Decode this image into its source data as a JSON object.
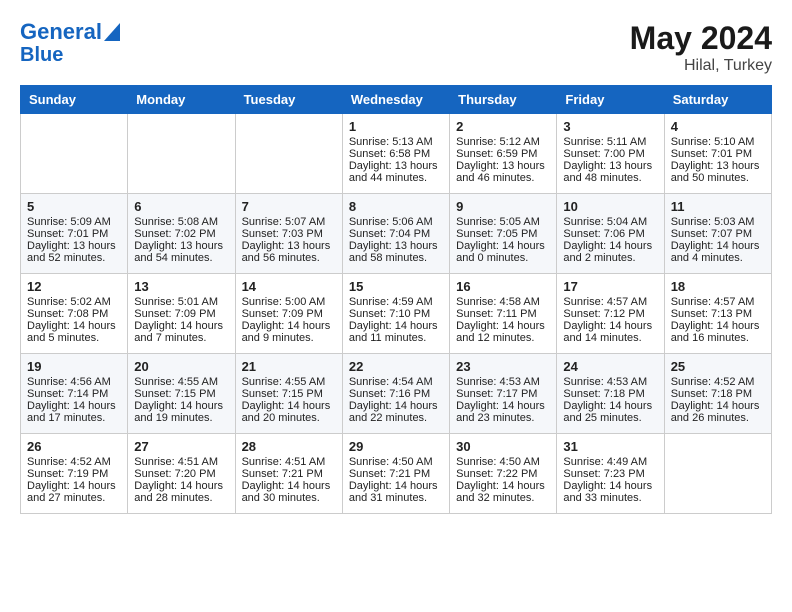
{
  "header": {
    "logo_line1": "General",
    "logo_line2": "Blue",
    "month_year": "May 2024",
    "location": "Hilal, Turkey"
  },
  "weekdays": [
    "Sunday",
    "Monday",
    "Tuesday",
    "Wednesday",
    "Thursday",
    "Friday",
    "Saturday"
  ],
  "weeks": [
    [
      {
        "day": "",
        "sunrise": "",
        "sunset": "",
        "daylight": ""
      },
      {
        "day": "",
        "sunrise": "",
        "sunset": "",
        "daylight": ""
      },
      {
        "day": "",
        "sunrise": "",
        "sunset": "",
        "daylight": ""
      },
      {
        "day": "1",
        "sunrise": "Sunrise: 5:13 AM",
        "sunset": "Sunset: 6:58 PM",
        "daylight": "Daylight: 13 hours and 44 minutes."
      },
      {
        "day": "2",
        "sunrise": "Sunrise: 5:12 AM",
        "sunset": "Sunset: 6:59 PM",
        "daylight": "Daylight: 13 hours and 46 minutes."
      },
      {
        "day": "3",
        "sunrise": "Sunrise: 5:11 AM",
        "sunset": "Sunset: 7:00 PM",
        "daylight": "Daylight: 13 hours and 48 minutes."
      },
      {
        "day": "4",
        "sunrise": "Sunrise: 5:10 AM",
        "sunset": "Sunset: 7:01 PM",
        "daylight": "Daylight: 13 hours and 50 minutes."
      }
    ],
    [
      {
        "day": "5",
        "sunrise": "Sunrise: 5:09 AM",
        "sunset": "Sunset: 7:01 PM",
        "daylight": "Daylight: 13 hours and 52 minutes."
      },
      {
        "day": "6",
        "sunrise": "Sunrise: 5:08 AM",
        "sunset": "Sunset: 7:02 PM",
        "daylight": "Daylight: 13 hours and 54 minutes."
      },
      {
        "day": "7",
        "sunrise": "Sunrise: 5:07 AM",
        "sunset": "Sunset: 7:03 PM",
        "daylight": "Daylight: 13 hours and 56 minutes."
      },
      {
        "day": "8",
        "sunrise": "Sunrise: 5:06 AM",
        "sunset": "Sunset: 7:04 PM",
        "daylight": "Daylight: 13 hours and 58 minutes."
      },
      {
        "day": "9",
        "sunrise": "Sunrise: 5:05 AM",
        "sunset": "Sunset: 7:05 PM",
        "daylight": "Daylight: 14 hours and 0 minutes."
      },
      {
        "day": "10",
        "sunrise": "Sunrise: 5:04 AM",
        "sunset": "Sunset: 7:06 PM",
        "daylight": "Daylight: 14 hours and 2 minutes."
      },
      {
        "day": "11",
        "sunrise": "Sunrise: 5:03 AM",
        "sunset": "Sunset: 7:07 PM",
        "daylight": "Daylight: 14 hours and 4 minutes."
      }
    ],
    [
      {
        "day": "12",
        "sunrise": "Sunrise: 5:02 AM",
        "sunset": "Sunset: 7:08 PM",
        "daylight": "Daylight: 14 hours and 5 minutes."
      },
      {
        "day": "13",
        "sunrise": "Sunrise: 5:01 AM",
        "sunset": "Sunset: 7:09 PM",
        "daylight": "Daylight: 14 hours and 7 minutes."
      },
      {
        "day": "14",
        "sunrise": "Sunrise: 5:00 AM",
        "sunset": "Sunset: 7:09 PM",
        "daylight": "Daylight: 14 hours and 9 minutes."
      },
      {
        "day": "15",
        "sunrise": "Sunrise: 4:59 AM",
        "sunset": "Sunset: 7:10 PM",
        "daylight": "Daylight: 14 hours and 11 minutes."
      },
      {
        "day": "16",
        "sunrise": "Sunrise: 4:58 AM",
        "sunset": "Sunset: 7:11 PM",
        "daylight": "Daylight: 14 hours and 12 minutes."
      },
      {
        "day": "17",
        "sunrise": "Sunrise: 4:57 AM",
        "sunset": "Sunset: 7:12 PM",
        "daylight": "Daylight: 14 hours and 14 minutes."
      },
      {
        "day": "18",
        "sunrise": "Sunrise: 4:57 AM",
        "sunset": "Sunset: 7:13 PM",
        "daylight": "Daylight: 14 hours and 16 minutes."
      }
    ],
    [
      {
        "day": "19",
        "sunrise": "Sunrise: 4:56 AM",
        "sunset": "Sunset: 7:14 PM",
        "daylight": "Daylight: 14 hours and 17 minutes."
      },
      {
        "day": "20",
        "sunrise": "Sunrise: 4:55 AM",
        "sunset": "Sunset: 7:15 PM",
        "daylight": "Daylight: 14 hours and 19 minutes."
      },
      {
        "day": "21",
        "sunrise": "Sunrise: 4:55 AM",
        "sunset": "Sunset: 7:15 PM",
        "daylight": "Daylight: 14 hours and 20 minutes."
      },
      {
        "day": "22",
        "sunrise": "Sunrise: 4:54 AM",
        "sunset": "Sunset: 7:16 PM",
        "daylight": "Daylight: 14 hours and 22 minutes."
      },
      {
        "day": "23",
        "sunrise": "Sunrise: 4:53 AM",
        "sunset": "Sunset: 7:17 PM",
        "daylight": "Daylight: 14 hours and 23 minutes."
      },
      {
        "day": "24",
        "sunrise": "Sunrise: 4:53 AM",
        "sunset": "Sunset: 7:18 PM",
        "daylight": "Daylight: 14 hours and 25 minutes."
      },
      {
        "day": "25",
        "sunrise": "Sunrise: 4:52 AM",
        "sunset": "Sunset: 7:18 PM",
        "daylight": "Daylight: 14 hours and 26 minutes."
      }
    ],
    [
      {
        "day": "26",
        "sunrise": "Sunrise: 4:52 AM",
        "sunset": "Sunset: 7:19 PM",
        "daylight": "Daylight: 14 hours and 27 minutes."
      },
      {
        "day": "27",
        "sunrise": "Sunrise: 4:51 AM",
        "sunset": "Sunset: 7:20 PM",
        "daylight": "Daylight: 14 hours and 28 minutes."
      },
      {
        "day": "28",
        "sunrise": "Sunrise: 4:51 AM",
        "sunset": "Sunset: 7:21 PM",
        "daylight": "Daylight: 14 hours and 30 minutes."
      },
      {
        "day": "29",
        "sunrise": "Sunrise: 4:50 AM",
        "sunset": "Sunset: 7:21 PM",
        "daylight": "Daylight: 14 hours and 31 minutes."
      },
      {
        "day": "30",
        "sunrise": "Sunrise: 4:50 AM",
        "sunset": "Sunset: 7:22 PM",
        "daylight": "Daylight: 14 hours and 32 minutes."
      },
      {
        "day": "31",
        "sunrise": "Sunrise: 4:49 AM",
        "sunset": "Sunset: 7:23 PM",
        "daylight": "Daylight: 14 hours and 33 minutes."
      },
      {
        "day": "",
        "sunrise": "",
        "sunset": "",
        "daylight": ""
      }
    ]
  ]
}
